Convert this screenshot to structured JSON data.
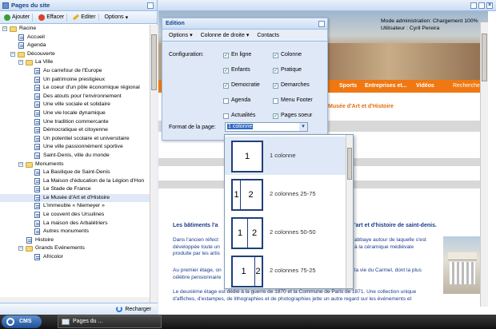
{
  "left_panel": {
    "title": "Pages du site",
    "toolbar": {
      "add": "Ajouter",
      "delete": "Effacer",
      "edit": "Editer",
      "options": "Options"
    },
    "tree": [
      {
        "label": "Racine",
        "type": "folder",
        "level": 0,
        "expanded": true
      },
      {
        "label": "Accueil",
        "type": "page",
        "level": 1
      },
      {
        "label": "Agenda",
        "type": "page",
        "level": 1
      },
      {
        "label": "Découverte",
        "type": "folder",
        "level": 1,
        "expanded": true
      },
      {
        "label": "La Ville",
        "type": "folder",
        "level": 2,
        "expanded": true
      },
      {
        "label": "Au carrefour de l'Europe",
        "type": "page",
        "level": 3
      },
      {
        "label": "Un patrimoine prestigieux",
        "type": "page",
        "level": 3
      },
      {
        "label": "Le coeur d'un pôle économique régional",
        "type": "page",
        "level": 3
      },
      {
        "label": "Des atouts pour l'environnement",
        "type": "page",
        "level": 3
      },
      {
        "label": "Une ville sociale et solidaire",
        "type": "page",
        "level": 3
      },
      {
        "label": "Une vie locale dynamique",
        "type": "page",
        "level": 3
      },
      {
        "label": "Une tradition commercante",
        "type": "page",
        "level": 3
      },
      {
        "label": "Démocratique et citoyenne",
        "type": "page",
        "level": 3
      },
      {
        "label": "Un potentiel scolaire et universitaire",
        "type": "page",
        "level": 3
      },
      {
        "label": "Une ville passionnément sportive",
        "type": "page",
        "level": 3
      },
      {
        "label": "Saint-Denis, ville du monde",
        "type": "page",
        "level": 3
      },
      {
        "label": "Monuments",
        "type": "folder",
        "level": 2,
        "expanded": true
      },
      {
        "label": "La Basilique de Saint-Denis",
        "type": "page",
        "level": 3
      },
      {
        "label": "La Maison d'éducation de la Légion d'Hon",
        "type": "page",
        "level": 3
      },
      {
        "label": "Le Stade de France",
        "type": "page",
        "level": 3
      },
      {
        "label": "Le Musée d'Art et d'Histoire",
        "type": "page",
        "level": 3,
        "selected": true
      },
      {
        "label": "L'immeuble « Niemeyer »",
        "type": "page",
        "level": 3
      },
      {
        "label": "Le couvent des Ursulines",
        "type": "page",
        "level": 3
      },
      {
        "label": "La maison des Arbalétriers",
        "type": "page",
        "level": 3
      },
      {
        "label": "Autres monuments",
        "type": "page",
        "level": 3
      },
      {
        "label": "Histoire",
        "type": "page",
        "level": 2
      },
      {
        "label": "Grands Evénements",
        "type": "folder",
        "level": 2,
        "expanded": true
      },
      {
        "label": "Africolor",
        "type": "page",
        "level": 3
      }
    ],
    "reload": "Recharger"
  },
  "website": {
    "admin_mode": "Mode administration: Chargement 100%",
    "user": "Utilisateur : Cyril Pereira",
    "nav": [
      "Sports",
      "Entreprises et...",
      "Vidéos"
    ],
    "search": "Recherche",
    "page_title": "Musée d'Art et d'Histoire",
    "heading": "Les bâtiments l'art et d'histoire de saint-denis.",
    "heading_left": "Les bâtiments l'a",
    "heading_right": "'art et d'histoire de saint-denis.",
    "para1_left": "Dans l'ancien réfect",
    "para1_left2": "développée toute un",
    "para1_left3": "produite par les artis",
    "para1_right": "abbaye autour de laquelle s'est",
    "para1_right2": "à la céramique médiévale",
    "para2_left": "Au premier étage, on",
    "para2_left2": "célèbre pensionnaire",
    "para2_right": "la vie du Carmel, dont la plus",
    "para3": "Le deuxième étage est dédié à la guerre de 1870 et la Commune de Paris de 1871. Une collection unique",
    "para3b": "d'affiches, d'estampes, de lithographies et de photographies jette un autre regard sur les événements et"
  },
  "edition": {
    "title": "Edition",
    "menu": [
      "Options",
      "Colonne de droite",
      "Contacts"
    ],
    "configuration_label": "Configuration:",
    "checkboxes": [
      {
        "label": "En ligne",
        "checked": true
      },
      {
        "label": "Colonne",
        "checked": true
      },
      {
        "label": "Enfants",
        "checked": true
      },
      {
        "label": "Pratique",
        "checked": true
      },
      {
        "label": "Democratie",
        "checked": true
      },
      {
        "label": "Demarches",
        "checked": true
      },
      {
        "label": "Agenda",
        "checked": false
      },
      {
        "label": "Menu Footer",
        "checked": false
      },
      {
        "label": "Actualités",
        "checked": false
      },
      {
        "label": "Pages soeur",
        "checked": true
      }
    ],
    "format_label": "Format de la page:",
    "format_value": "1 colonne"
  },
  "dropdown_options": [
    {
      "label": "1 colonne",
      "cells": [
        "1"
      ]
    },
    {
      "label": "2 colonnes 25-75",
      "cells": [
        "1",
        "2"
      ]
    },
    {
      "label": "2 colonnes 50-50",
      "cells": [
        "1",
        "2"
      ]
    },
    {
      "label": "2 colonnes 75-25",
      "cells": [
        "1",
        "2"
      ]
    }
  ],
  "taskbar": {
    "start": "CMS",
    "item": "Pages du ..."
  }
}
